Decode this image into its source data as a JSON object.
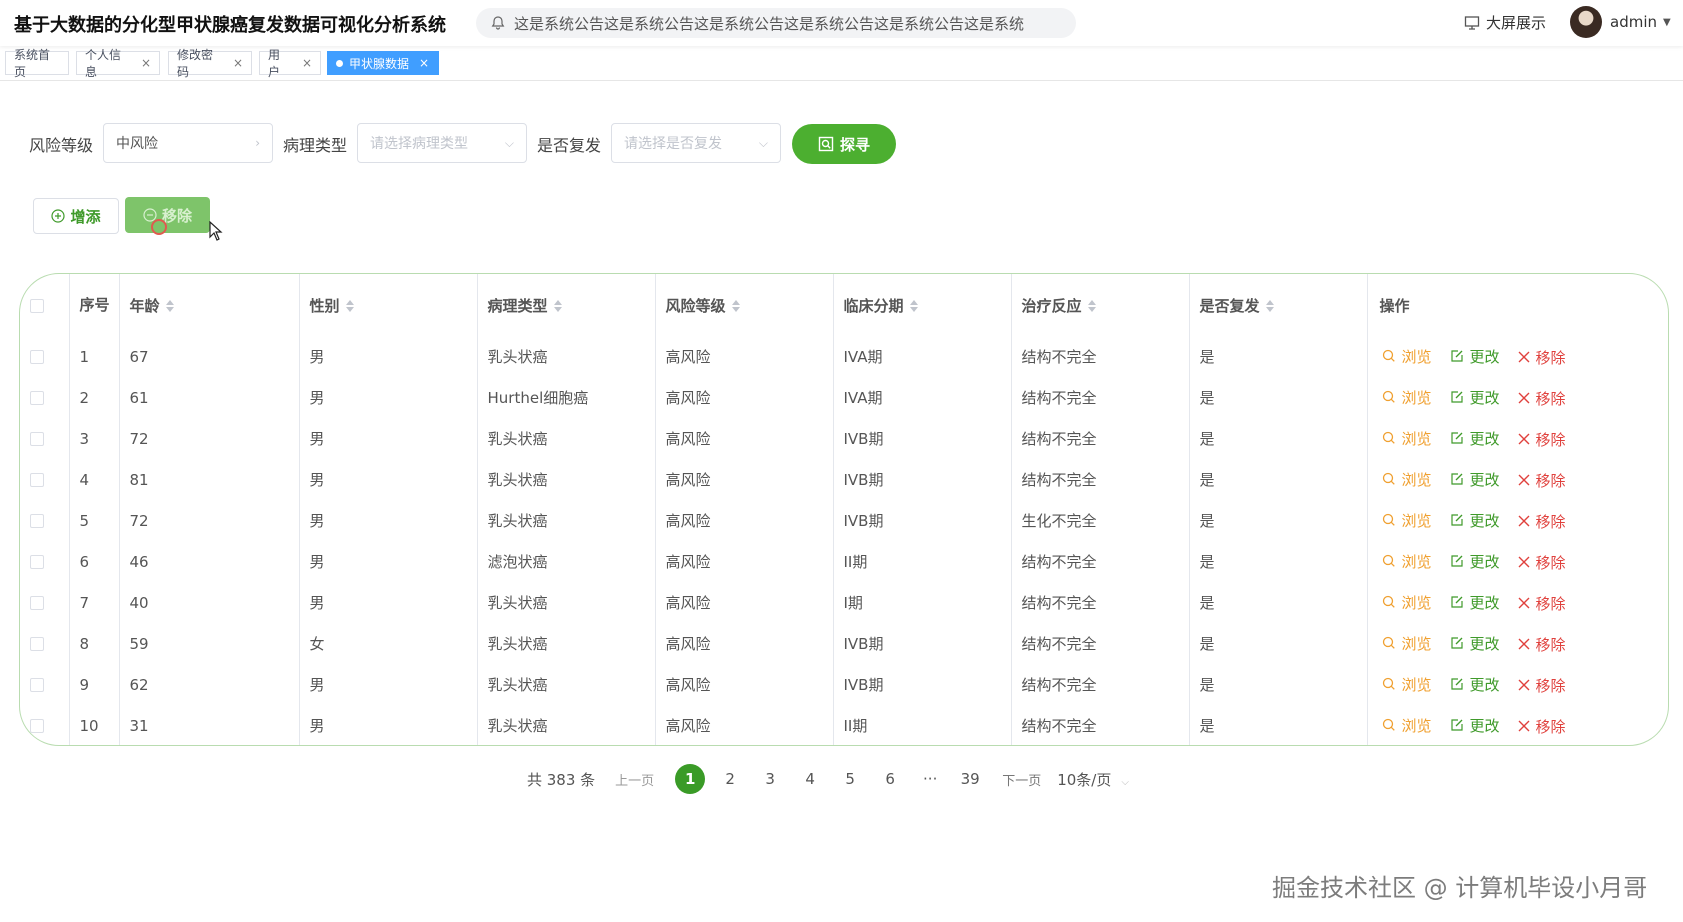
{
  "header": {
    "title": "基于大数据的分化型甲状腺癌复发数据可视化分析系统",
    "notice": "这是系统公告这是系统公告这是系统公告这是系统公告这是系统公告这是系统",
    "big_screen_label": "大屏展示",
    "username": "admin"
  },
  "tabs": [
    {
      "label": "系统首页",
      "closable": false
    },
    {
      "label": "个人信息",
      "closable": true
    },
    {
      "label": "修改密码",
      "closable": true
    },
    {
      "label": "用户",
      "closable": true
    },
    {
      "label": "甲状腺数据",
      "closable": true,
      "active": true
    }
  ],
  "search": {
    "risk_label": "风险等级",
    "risk_value": "中风险",
    "pathology_label": "病理类型",
    "pathology_placeholder": "请选择病理类型",
    "recurrence_label": "是否复发",
    "recurrence_placeholder": "请选择是否复发",
    "search_button": "探寻"
  },
  "actions": {
    "add_label": "增添",
    "delete_label": "移除"
  },
  "table": {
    "columns": [
      "序号",
      "年龄",
      "性别",
      "病理类型",
      "风险等级",
      "临床分期",
      "治疗反应",
      "是否复发",
      "操作"
    ],
    "row_ops": {
      "view": "浏览",
      "edit": "更改",
      "remove": "移除"
    },
    "rows": [
      [
        "1",
        "67",
        "男",
        "乳头状癌",
        "高风险",
        "IVA期",
        "结构不完全",
        "是"
      ],
      [
        "2",
        "61",
        "男",
        "Hurthel细胞癌",
        "高风险",
        "IVA期",
        "结构不完全",
        "是"
      ],
      [
        "3",
        "72",
        "男",
        "乳头状癌",
        "高风险",
        "IVB期",
        "结构不完全",
        "是"
      ],
      [
        "4",
        "81",
        "男",
        "乳头状癌",
        "高风险",
        "IVB期",
        "结构不完全",
        "是"
      ],
      [
        "5",
        "72",
        "男",
        "乳头状癌",
        "高风险",
        "IVB期",
        "生化不完全",
        "是"
      ],
      [
        "6",
        "46",
        "男",
        "滤泡状癌",
        "高风险",
        "II期",
        "结构不完全",
        "是"
      ],
      [
        "7",
        "40",
        "男",
        "乳头状癌",
        "高风险",
        "I期",
        "结构不完全",
        "是"
      ],
      [
        "8",
        "59",
        "女",
        "乳头状癌",
        "高风险",
        "IVB期",
        "结构不完全",
        "是"
      ],
      [
        "9",
        "62",
        "男",
        "乳头状癌",
        "高风险",
        "IVB期",
        "结构不完全",
        "是"
      ],
      [
        "10",
        "31",
        "男",
        "乳头状癌",
        "高风险",
        "II期",
        "结构不完全",
        "是"
      ]
    ]
  },
  "pagination": {
    "total": "共 383 条",
    "prev": "上一页",
    "pages": [
      "1",
      "2",
      "3",
      "4",
      "5",
      "6",
      "···",
      "39"
    ],
    "current": "1",
    "next": "下一页",
    "page_size": "10条/页"
  },
  "watermark": "掘金技术社区 @ 计算机毕设小月哥"
}
